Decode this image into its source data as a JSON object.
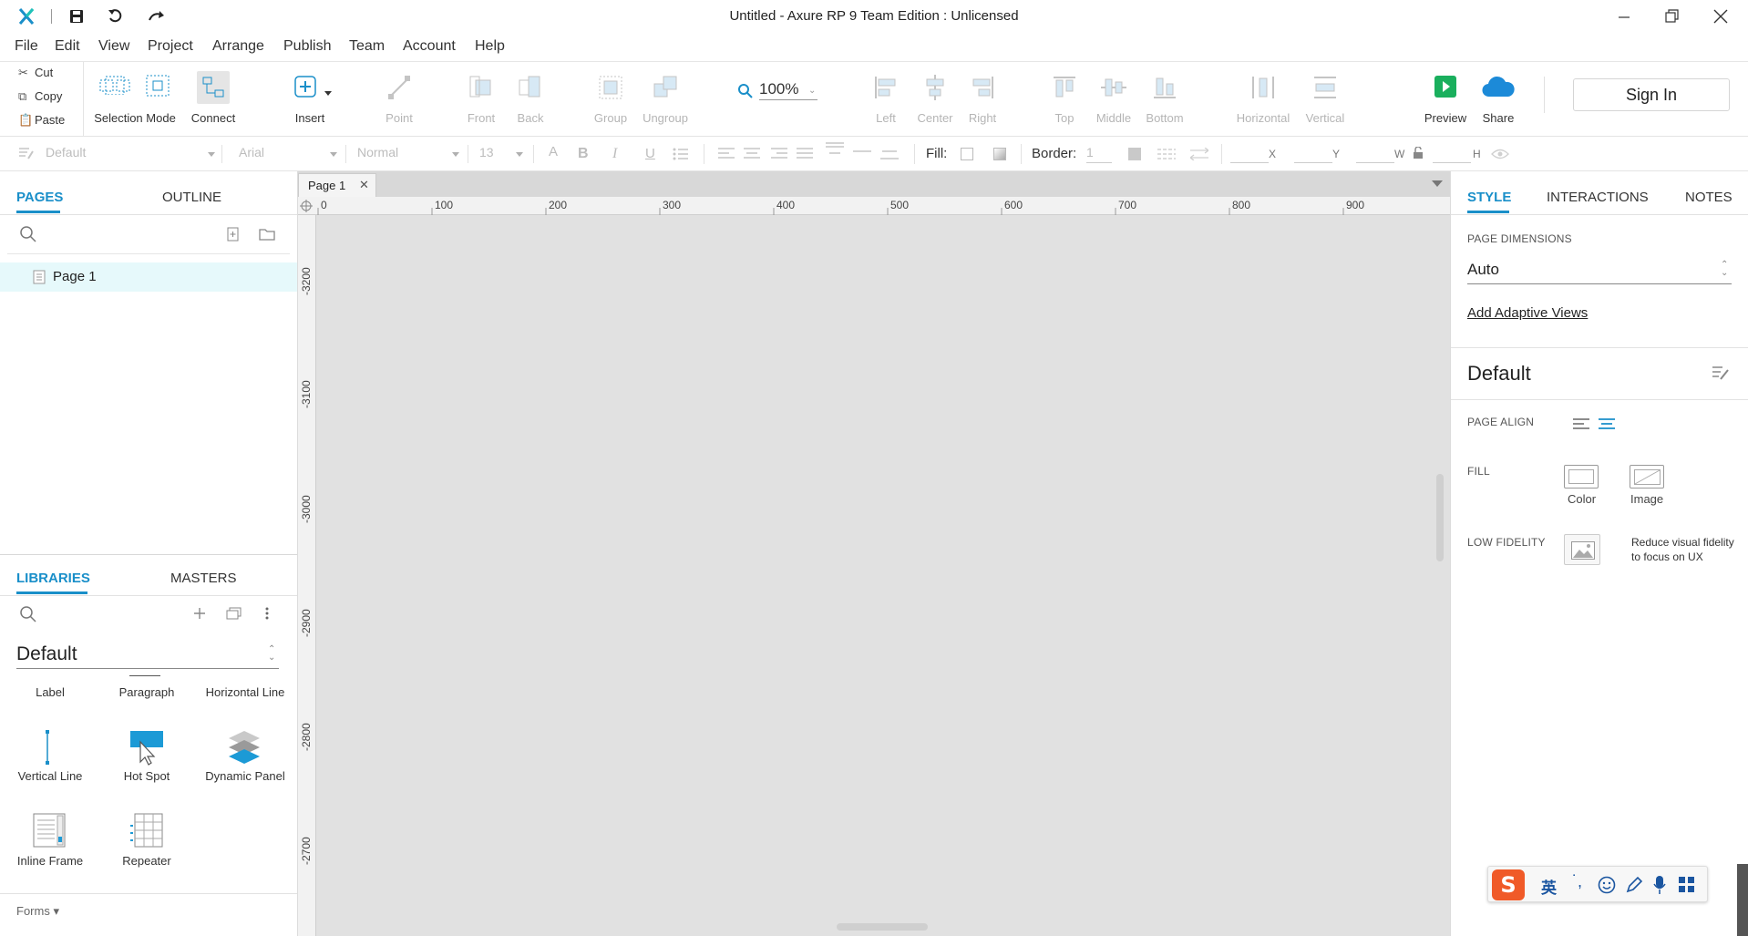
{
  "window": {
    "title": "Untitled - Axure RP 9 Team Edition : Unlicensed"
  },
  "menu": [
    "File",
    "Edit",
    "View",
    "Project",
    "Arrange",
    "Publish",
    "Team",
    "Account",
    "Help"
  ],
  "clipboard": {
    "cut": "Cut",
    "copy": "Copy",
    "paste": "Paste"
  },
  "toolbar": {
    "selection_mode": "Selection Mode",
    "connect": "Connect",
    "insert": "Insert",
    "point": "Point",
    "front": "Front",
    "back": "Back",
    "group": "Group",
    "ungroup": "Ungroup",
    "zoom": "100%",
    "left": "Left",
    "center": "Center",
    "right": "Right",
    "top": "Top",
    "middle": "Middle",
    "bottom": "Bottom",
    "horizontal": "Horizontal",
    "vertical": "Vertical",
    "preview": "Preview",
    "share": "Share",
    "sign_in": "Sign In"
  },
  "format": {
    "style": "Default",
    "font": "Arial",
    "weight": "Normal",
    "size": "13",
    "fill_label": "Fill:",
    "border_label": "Border:",
    "border_value": "1",
    "x": "X",
    "y": "Y",
    "w": "W",
    "h": "H"
  },
  "left_panel": {
    "tabs": {
      "pages": "PAGES",
      "outline": "OUTLINE"
    },
    "pages": [
      "Page 1"
    ],
    "lib_tabs": {
      "libraries": "LIBRARIES",
      "masters": "MASTERS"
    },
    "library_name": "Default",
    "widgets": [
      "Label",
      "Paragraph",
      "Horizontal Line",
      "Vertical Line",
      "Hot Spot",
      "Dynamic Panel",
      "Inline Frame",
      "Repeater"
    ],
    "forms": "Forms ▾"
  },
  "canvas": {
    "tab": "Page 1",
    "h_ruler": [
      "0",
      "100",
      "200",
      "300",
      "400",
      "500",
      "600",
      "700",
      "800",
      "900"
    ],
    "v_ruler": [
      "-3200",
      "-3100",
      "-3000",
      "-2900",
      "-2800",
      "-2700"
    ]
  },
  "right_panel": {
    "tabs": {
      "style": "STYLE",
      "interactions": "INTERACTIONS",
      "notes": "NOTES"
    },
    "page_dimensions_label": "PAGE DIMENSIONS",
    "page_dimensions_value": "Auto",
    "add_adaptive": "Add Adaptive Views",
    "style_name": "Default",
    "page_align": "PAGE ALIGN",
    "fill": "FILL",
    "fill_color": "Color",
    "fill_image": "Image",
    "low_fidelity": "LOW FIDELITY",
    "low_fidelity_desc_1": "Reduce visual fidelity",
    "low_fidelity_desc_2": "to focus on UX"
  },
  "ime": {
    "lang": "英"
  },
  "colors": {
    "accent": "#1a8fc9",
    "preview_green": "#1aaf5d",
    "share_blue": "#1c8ad8",
    "page_row": "#e6f9fb"
  }
}
